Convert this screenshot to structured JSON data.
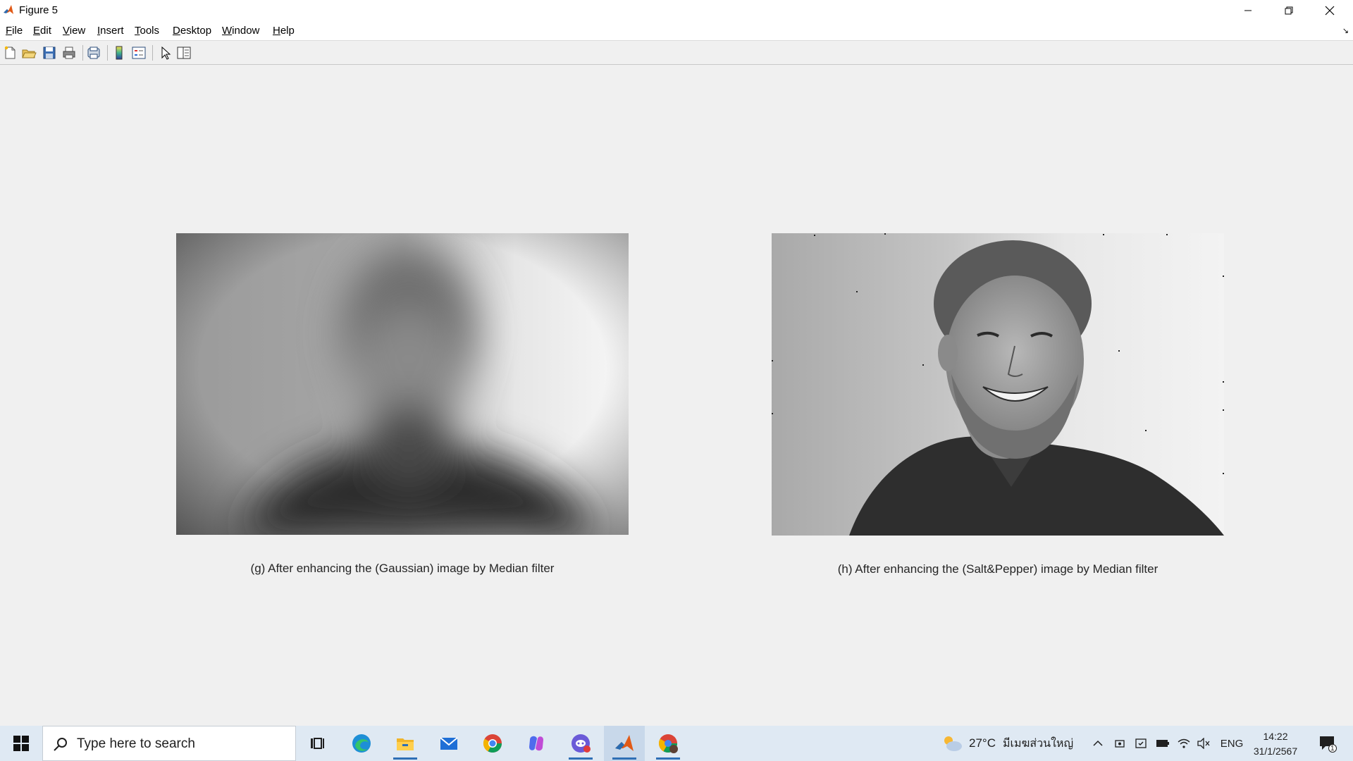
{
  "window": {
    "title": "Figure 5",
    "controls": [
      "minimize-icon",
      "restore-icon",
      "close-icon"
    ]
  },
  "menubar": {
    "items": [
      {
        "label": "File",
        "mnemonic": "F",
        "rest": "ile"
      },
      {
        "label": "Edit",
        "mnemonic": "E",
        "rest": "dit"
      },
      {
        "label": "View",
        "mnemonic": "V",
        "rest": "iew"
      },
      {
        "label": "Insert",
        "mnemonic": "I",
        "rest": "nsert"
      },
      {
        "label": "Tools",
        "mnemonic": "T",
        "rest": "ools"
      },
      {
        "label": "Desktop",
        "mnemonic": "D",
        "rest": "esktop"
      },
      {
        "label": "Window",
        "mnemonic": "W",
        "rest": "indow"
      },
      {
        "label": "Help",
        "mnemonic": "H",
        "rest": "elp"
      }
    ],
    "dock_icon": "dock-arrow-icon"
  },
  "toolbar": {
    "buttons": [
      "new-figure-icon",
      "open-file-icon",
      "save-icon",
      "print-icon",
      "print-preview-icon",
      "colorbar-icon",
      "legend-icon",
      "edit-plot-pointer-icon",
      "property-editor-icon"
    ]
  },
  "figure": {
    "left_caption": "(g) After enhancing the (Gaussian) image by Median filter",
    "right_caption": "(h) After enhancing the (Salt&Pepper) image by Median filter"
  },
  "taskbar": {
    "search_placeholder": "Type here to search",
    "apps": [
      "task-view-icon",
      "edge-icon",
      "file-explorer-icon",
      "mail-icon",
      "chrome-icon",
      "copilot-icon",
      "discord-icon",
      "matlab-icon",
      "chrome-profile-icon"
    ],
    "weather": "27°C",
    "weather_desc": "มีเมฆส่วนใหญ่",
    "lang": "ENG",
    "time": "14:22",
    "date": "31/1/2567",
    "notification_count": "1"
  }
}
